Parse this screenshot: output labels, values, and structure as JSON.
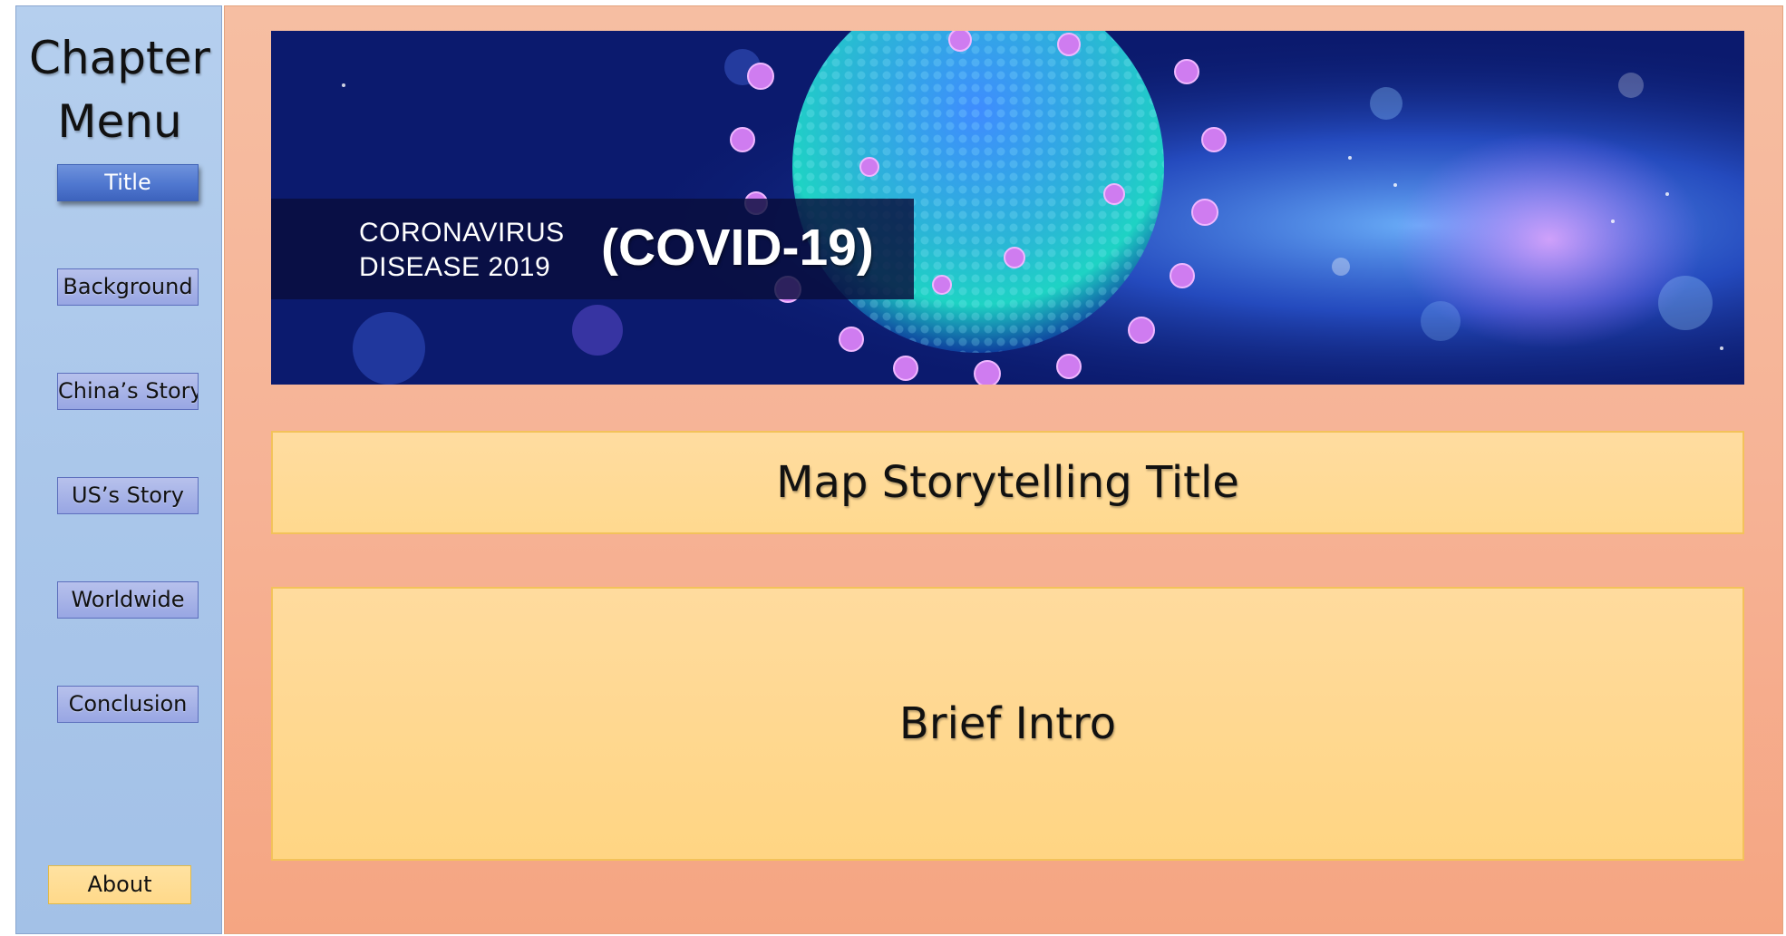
{
  "sidebar": {
    "heading": "Chapter\nMenu",
    "items": [
      {
        "label": "Title",
        "active": true
      },
      {
        "label": "Background",
        "active": false
      },
      {
        "label": "China’s Story",
        "active": false
      },
      {
        "label": "US’s Story",
        "active": false
      },
      {
        "label": "Worldwide",
        "active": false
      },
      {
        "label": "Conclusion",
        "active": false
      }
    ],
    "about_label": "About"
  },
  "banner": {
    "line1": "CORONAVIRUS",
    "line2": "DISEASE 2019",
    "big_text": "(COVID-19)"
  },
  "main": {
    "title_text": "Map Storytelling Title",
    "intro_text": "Brief Intro"
  },
  "colors": {
    "sidebar_bg": "#a9c6ea",
    "main_bg": "#f6b396",
    "box_bg": "#ffd98f",
    "active_button": "#4f77cf"
  }
}
